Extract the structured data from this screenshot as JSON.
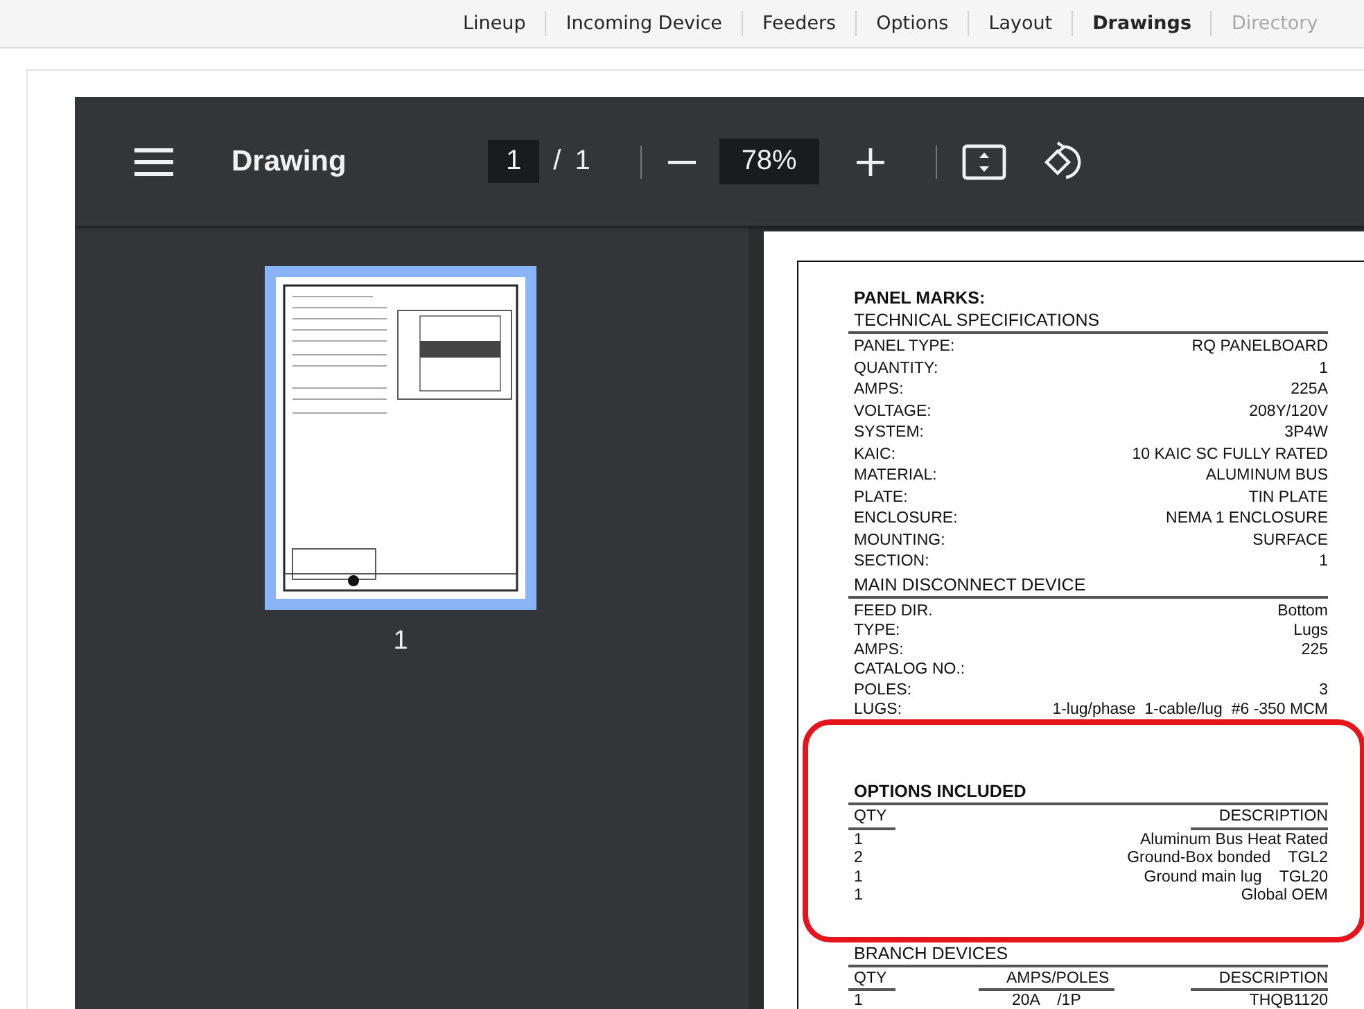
{
  "nav_tabs": [
    {
      "label": "Lineup",
      "selected": false,
      "disabled": false
    },
    {
      "label": "Incoming Device",
      "selected": false,
      "disabled": false
    },
    {
      "label": "Feeders",
      "selected": false,
      "disabled": false
    },
    {
      "label": "Options",
      "selected": false,
      "disabled": false
    },
    {
      "label": "Layout",
      "selected": false,
      "disabled": false
    },
    {
      "label": "Drawings",
      "selected": true,
      "disabled": false
    },
    {
      "label": "Directory",
      "selected": false,
      "disabled": true
    }
  ],
  "viewer": {
    "title": "Drawing",
    "page_current": "1",
    "page_total": "1",
    "page_separator": "/",
    "zoom": "78%",
    "thumbnails": [
      {
        "label": "1",
        "selected": true
      }
    ]
  },
  "document": {
    "title": "PANEL MARKS:",
    "sections": [
      {
        "kind": "fields",
        "heading": "TECHNICAL SPECIFICATIONS",
        "highlighted": false,
        "rows": [
          {
            "label": "PANEL TYPE:",
            "value": "RQ PANELBOARD"
          },
          {
            "label": "QUANTITY:",
            "value": "1"
          },
          {
            "label": "AMPS:",
            "value": "225A"
          },
          {
            "label": "VOLTAGE:",
            "value": "208Y/120V"
          },
          {
            "label": "SYSTEM:",
            "value": "3P4W"
          },
          {
            "label": "KAIC:",
            "value": "10 KAIC SC FULLY RATED"
          },
          {
            "label": "MATERIAL:",
            "value": "ALUMINUM BUS"
          },
          {
            "label": "PLATE:",
            "value": "TIN PLATE"
          },
          {
            "label": "ENCLOSURE:",
            "value": "NEMA 1 ENCLOSURE"
          },
          {
            "label": "MOUNTING:",
            "value": "SURFACE"
          },
          {
            "label": "SECTION:",
            "value": "1"
          }
        ]
      },
      {
        "kind": "fields",
        "heading": "MAIN DISCONNECT DEVICE",
        "highlighted": false,
        "rows": [
          {
            "label": "FEED DIR.",
            "value": "Bottom"
          },
          {
            "label": "TYPE:",
            "value": "Lugs"
          },
          {
            "label": "AMPS:",
            "value": "225"
          },
          {
            "label": "CATALOG NO.:"
          },
          {
            "label": "POLES:",
            "value": "3"
          },
          {
            "label": "LUGS:",
            "value": "1-lug/phase  1-cable/lug  #6 -350 MCM"
          }
        ]
      },
      {
        "kind": "table",
        "heading": "OPTIONS INCLUDED",
        "highlighted": true,
        "columns": [
          "QTY",
          "DESCRIPTION"
        ],
        "rows": [
          [
            "1",
            "Aluminum Bus Heat Rated"
          ],
          [
            "2",
            "Ground-Box bonded    TGL2"
          ],
          [
            "1",
            "Ground main lug    TGL20"
          ],
          [
            "1",
            "Global OEM"
          ]
        ]
      },
      {
        "kind": "table",
        "heading": "BRANCH DEVICES",
        "highlighted": false,
        "columns": [
          "QTY",
          "AMPS/POLES",
          "DESCRIPTION"
        ],
        "rows": [
          [
            "1",
            "20A    /1P",
            "THQB1120"
          ]
        ]
      }
    ]
  }
}
